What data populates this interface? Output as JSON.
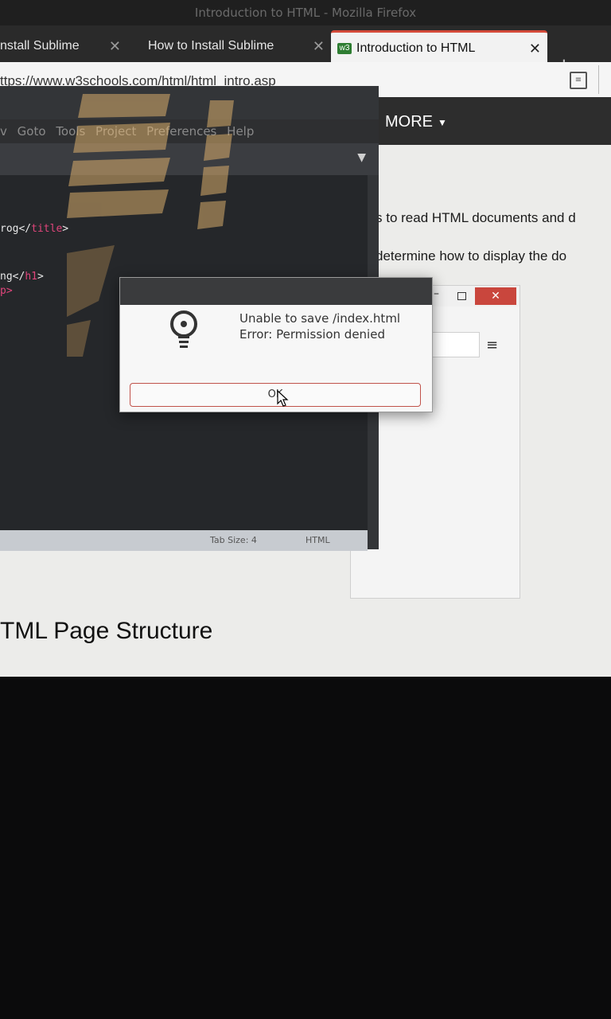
{
  "window": {
    "title": "Introduction to HTML - Mozilla Firefox"
  },
  "tabs": [
    {
      "label": "nstall Sublime"
    },
    {
      "label": "How to Install Sublime"
    },
    {
      "label": "Introduction to HTML",
      "active": true
    }
  ],
  "address_bar": {
    "url": "ttps://www.w3schools.com/html/html_intro.asp"
  },
  "site_nav": {
    "more_label": "MORE"
  },
  "page": {
    "line1": "s to read HTML documents and d",
    "line2": "determine how to display the do",
    "heading": "TML Page Structure"
  },
  "editor": {
    "menu": [
      "v",
      "Goto",
      "Tools",
      "Project",
      "Preferences",
      "Help"
    ],
    "code_lines": [
      {
        "pre": "rog</",
        "tag": "title",
        "post": ">"
      },
      {
        "pre": "ng</",
        "tag": "h1",
        "post": ">"
      },
      {
        "pre": "",
        "tag": "p>",
        "post": ""
      }
    ],
    "status_tab_size": "Tab Size: 4",
    "status_syntax": "HTML"
  },
  "dialog": {
    "line1": "Unable to save /index.html",
    "line2": "Error: Permission denied",
    "ok_label": "OK"
  },
  "colors": {
    "close_red": "#c9463d",
    "tag_pink": "#e0457b",
    "ok_border": "#c0524a"
  }
}
